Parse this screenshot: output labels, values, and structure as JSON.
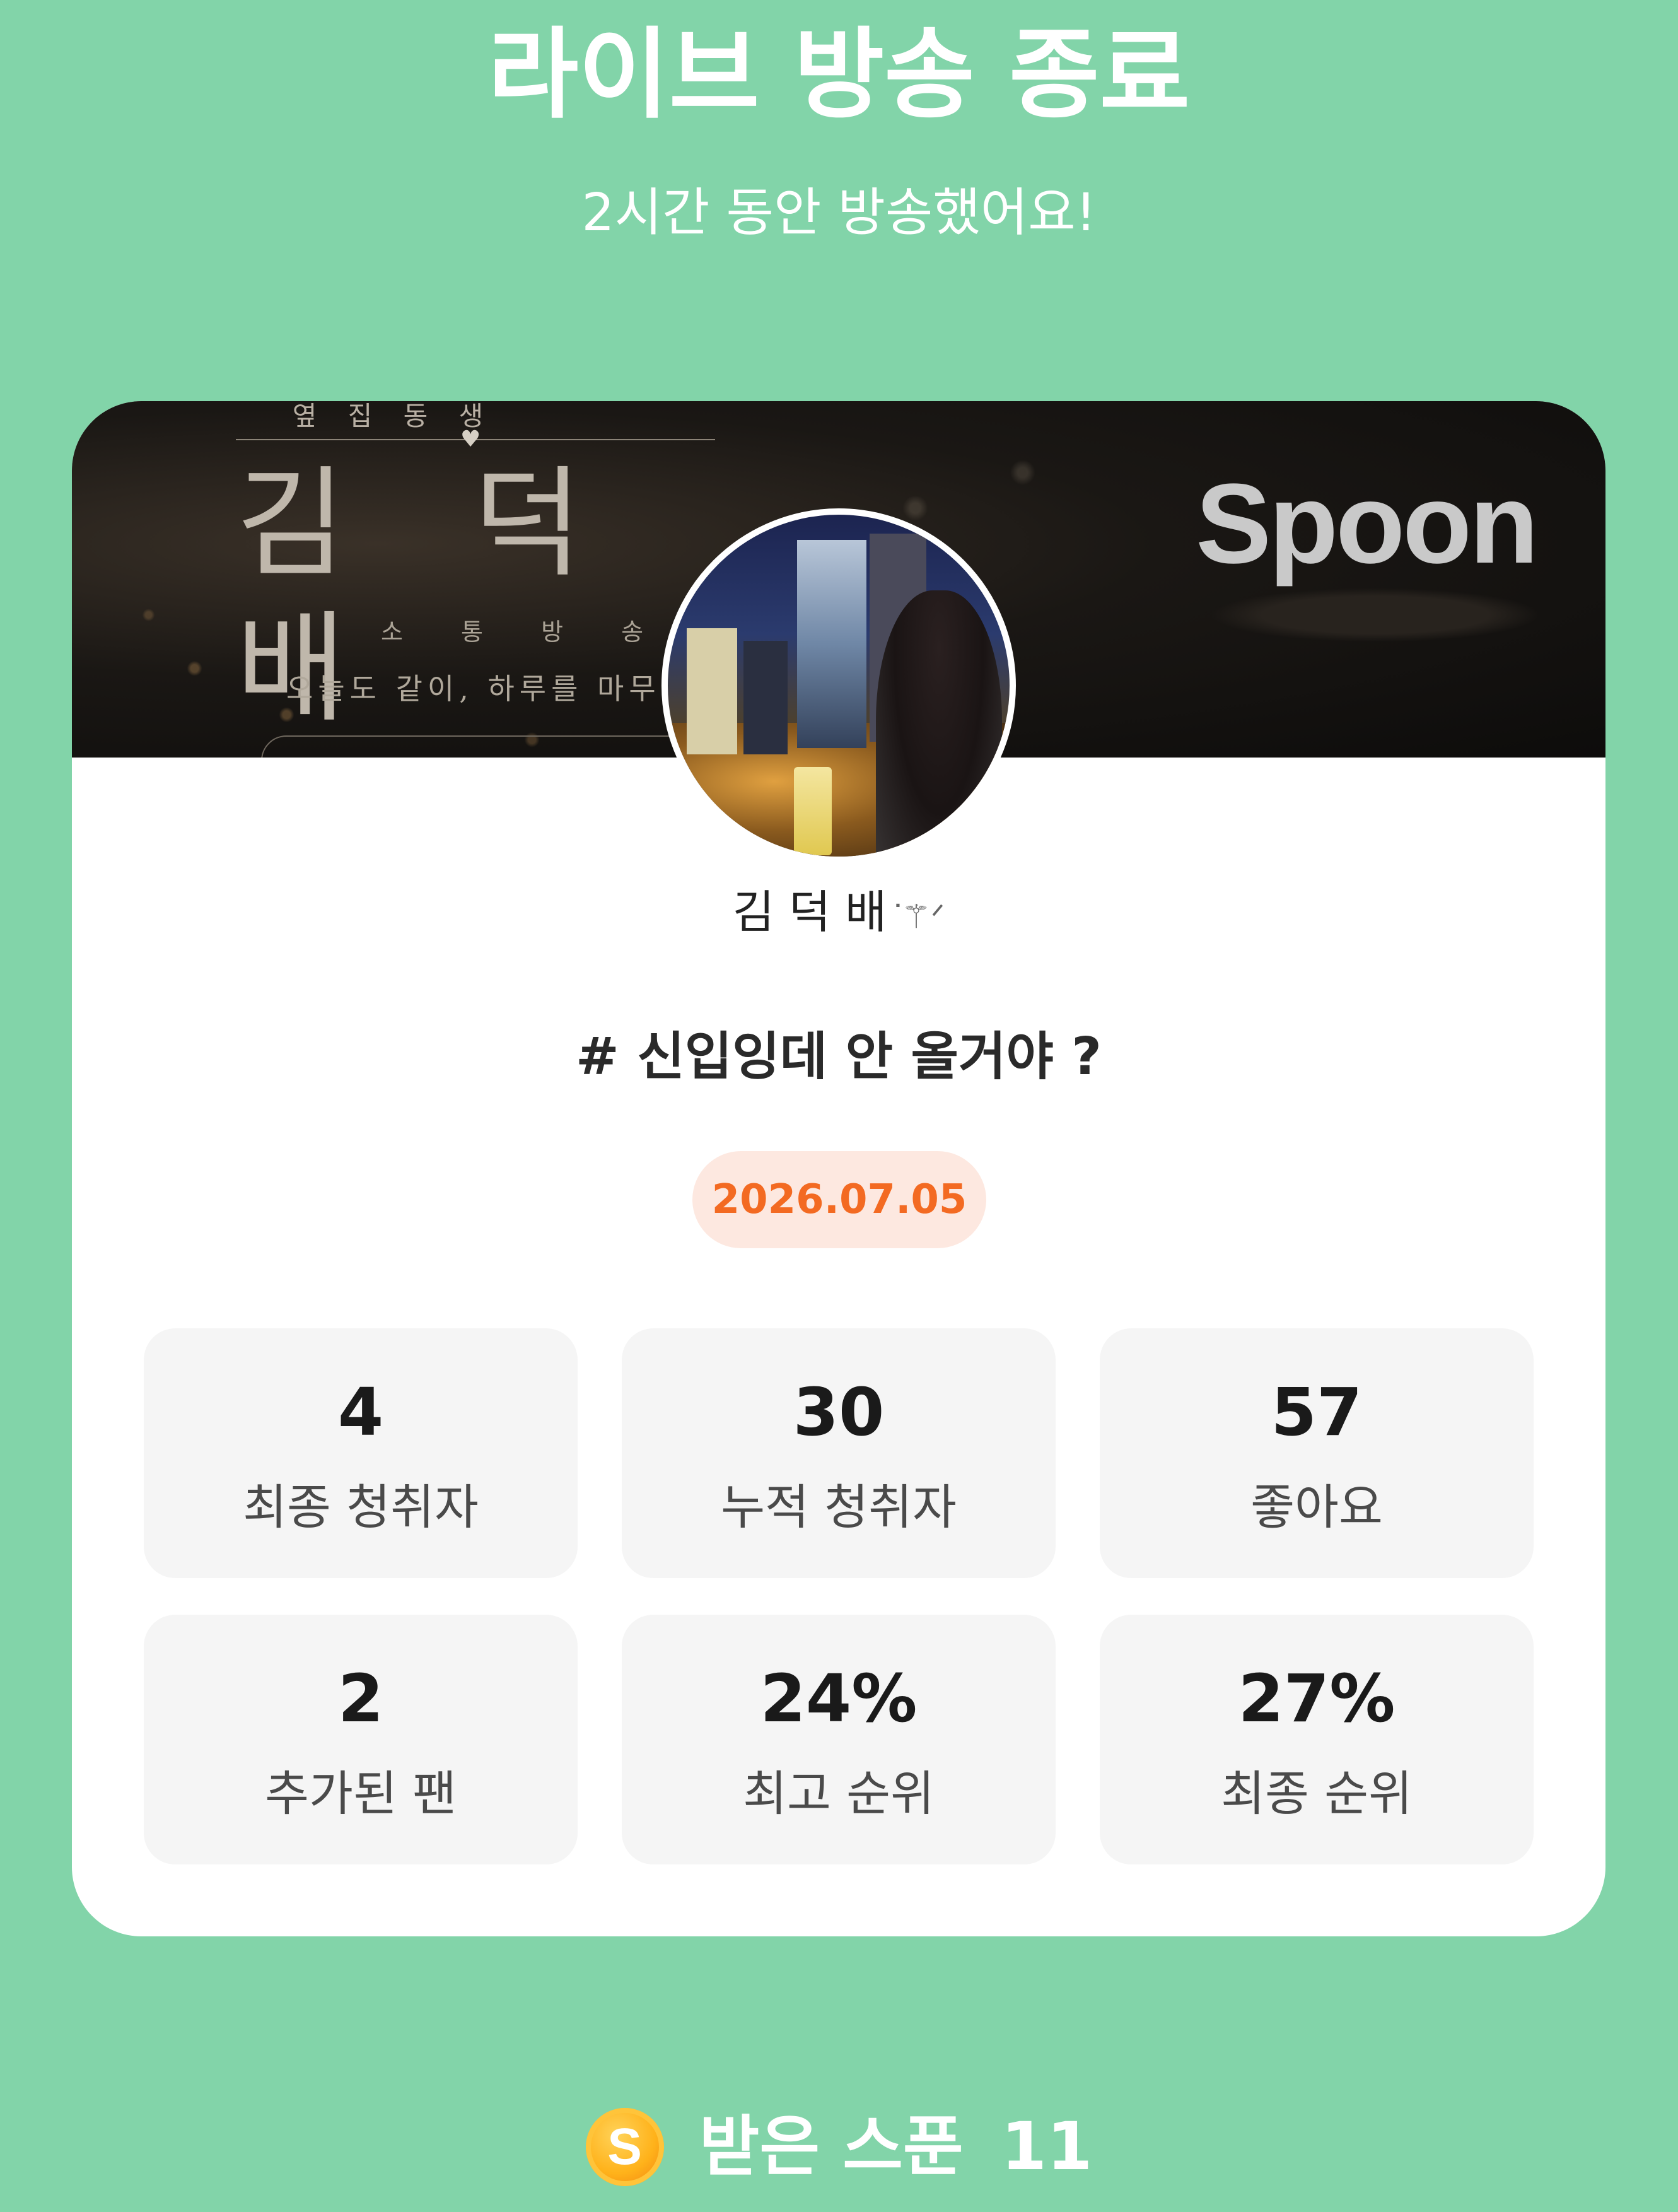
{
  "header": {
    "title": "라이브 방송 종료",
    "subtitle": "2시간 동안 방송했어요!"
  },
  "banner": {
    "top_text": "옆 집 동 생",
    "name_art": "김 덕 배",
    "tag": "소 통 방 송",
    "tagline": "오늘도 같이, 하루를 마무리해",
    "logo": "Spoon"
  },
  "profile": {
    "nickname": "김 덕 배",
    "nickname_deco": "ᐝ⚚ᐟ",
    "avatar_icon": "profile-photo"
  },
  "broadcast": {
    "title": "# 신입잉데 안 올거야 ?",
    "date": "2026.07.05"
  },
  "stats": [
    {
      "value": "4",
      "label": "최종 청취자"
    },
    {
      "value": "30",
      "label": "누적 청취자"
    },
    {
      "value": "57",
      "label": "좋아요"
    },
    {
      "value": "2",
      "label": "추가된 팬"
    },
    {
      "value": "24%",
      "label": "최고 순위"
    },
    {
      "value": "27%",
      "label": "최종 순위"
    }
  ],
  "footer": {
    "coin_letter": "S",
    "label": "받은 스푼",
    "count": "11"
  },
  "colors": {
    "background": "#82d4a9",
    "card": "#ffffff",
    "stat_bg": "#f5f5f5",
    "date_text": "#f36a22",
    "date_bg": "#fde8e0",
    "coin": "#ffb21a"
  }
}
